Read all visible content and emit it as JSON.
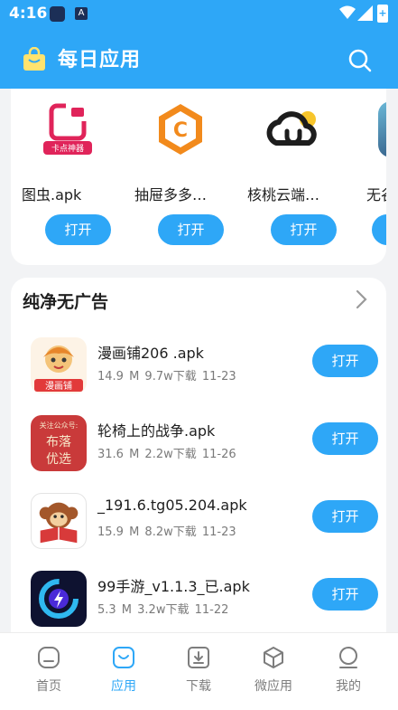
{
  "status_bar": {
    "time": "4:16",
    "notif_icon_2": "A",
    "battery_glyph": "+"
  },
  "header": {
    "title": "每日应用"
  },
  "featured": [
    {
      "name": "图虫.apk",
      "button": "打开",
      "icon": "tuchong-app-icon",
      "icon_caption": "卡点神器"
    },
    {
      "name": "抽屉多多…",
      "button": "打开",
      "icon": "chouti-app-icon",
      "icon_letter": "C"
    },
    {
      "name": "核桃云端…",
      "button": "打开",
      "icon": "hetao-cloud-app-icon"
    },
    {
      "name": "无谷",
      "button": "打开",
      "icon": "wugu-app-icon"
    }
  ],
  "section": {
    "title": "纯净无广告",
    "items": [
      {
        "name": "漫画铺206 .apk",
        "meta": "14.9 M  9.7w下载  11-23",
        "button": "打开",
        "icon": "manhuapu-app-icon",
        "icon_text": "漫画铺"
      },
      {
        "name": "轮椅上的战争.apk",
        "meta": "31.6 M  2.2w下载  11-26",
        "button": "打开",
        "icon": "wheelchair-war-app-icon",
        "icon_lines": [
          "关注公众号:",
          "布落",
          "优选"
        ]
      },
      {
        "name": "_191.6.tg05.204.apk",
        "meta": "15.9 M  8.2w下载  11-23",
        "button": "打开",
        "icon": "monkey-reader-app-icon"
      },
      {
        "name": "99手游_v1.1.3_已.apk",
        "meta": "5.3 M  3.2w下载  11-22",
        "button": "打开",
        "icon": "shouyou99-app-icon"
      }
    ]
  },
  "tabs": [
    {
      "label": "首页",
      "icon": "home-icon",
      "active": false
    },
    {
      "label": "应用",
      "icon": "apps-icon",
      "active": true
    },
    {
      "label": "下载",
      "icon": "download-icon",
      "active": false
    },
    {
      "label": "微应用",
      "icon": "cube-icon",
      "active": false
    },
    {
      "label": "我的",
      "icon": "profile-icon",
      "active": false
    }
  ],
  "colors": {
    "accent": "#2ea7f7",
    "background": "#f2f3f5",
    "meta_text": "#7a7a7a"
  }
}
